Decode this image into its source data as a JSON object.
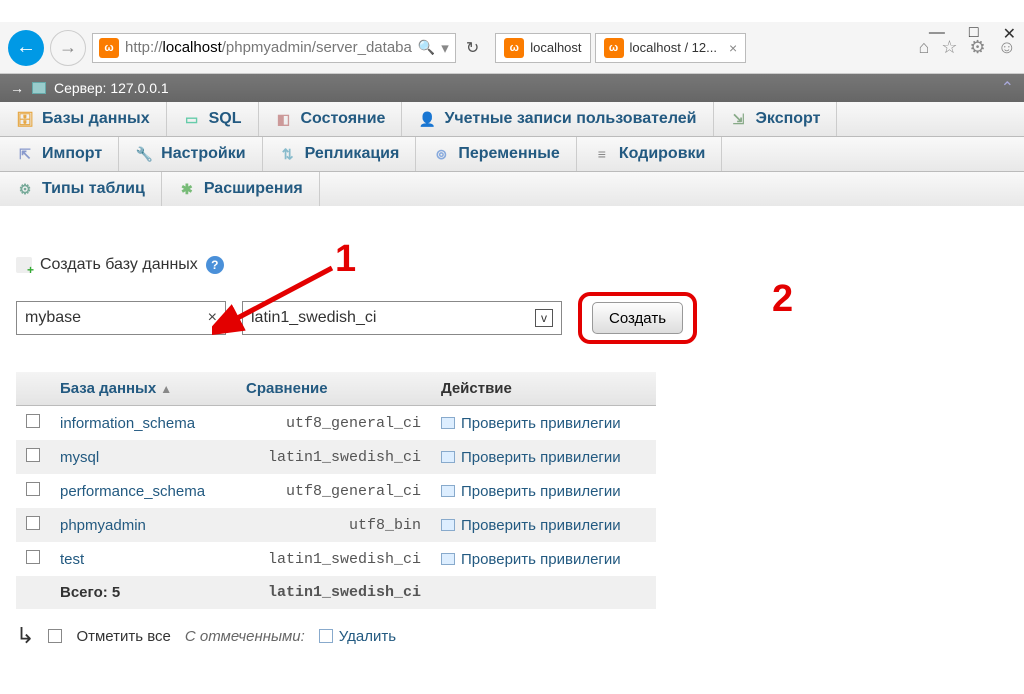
{
  "browser": {
    "url_prefix": "http://",
    "url_host": "localhost",
    "url_path": "/phpmyadmin/server_databa",
    "tabs": [
      {
        "label": "localhost"
      },
      {
        "label": "localhost / 12..."
      }
    ]
  },
  "server": {
    "label": "Сервер: 127.0.0.1"
  },
  "nav": {
    "databases": "Базы данных",
    "sql": "SQL",
    "status": "Состояние",
    "users": "Учетные записи пользователей",
    "export": "Экспорт",
    "import": "Импорт",
    "settings": "Настройки",
    "replication": "Репликация",
    "variables": "Переменные",
    "charsets": "Кодировки",
    "engines": "Типы таблиц",
    "plugins": "Расширения"
  },
  "create": {
    "heading": "Создать базу данных",
    "db_name": "mybase",
    "collation": "latin1_swedish_ci",
    "submit": "Создать"
  },
  "table": {
    "headers": {
      "db": "База данных",
      "collation": "Сравнение",
      "action": "Действие"
    },
    "action_label": "Проверить привилегии",
    "rows": [
      {
        "name": "information_schema",
        "collation": "utf8_general_ci"
      },
      {
        "name": "mysql",
        "collation": "latin1_swedish_ci"
      },
      {
        "name": "performance_schema",
        "collation": "utf8_general_ci"
      },
      {
        "name": "phpmyadmin",
        "collation": "utf8_bin"
      },
      {
        "name": "test",
        "collation": "latin1_swedish_ci"
      }
    ],
    "total_label": "Всего: 5",
    "total_collation": "latin1_swedish_ci"
  },
  "footer": {
    "check_all": "Отметить все",
    "with_selected": "С отмеченными:",
    "delete": "Удалить"
  },
  "annotations": {
    "one": "1",
    "two": "2"
  }
}
